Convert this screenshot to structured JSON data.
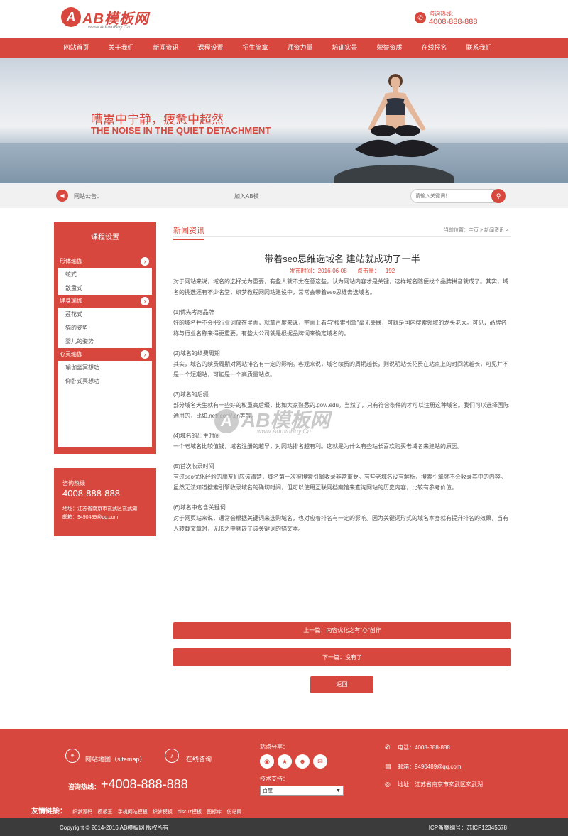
{
  "header": {
    "logo_mark": "A",
    "logo_text": "AB模板网",
    "logo_sub": "www.AdminBuy.Cn",
    "hotline_label": "咨询热线:",
    "hotline_number": "4008-888-888"
  },
  "nav": [
    "网站首页",
    "关于我们",
    "新闻资讯",
    "课程设置",
    "招生简章",
    "师资力量",
    "培训实景",
    "荣誉资质",
    "在线报名",
    "联系我们"
  ],
  "banner": {
    "headline_cn": "嘈嚣中宁静，疲惫中超然",
    "headline_en": "THE NOISE IN THE QUIET DETACHMENT"
  },
  "notice": {
    "label": "网站公告：",
    "text": "加入AB模",
    "search_placeholder": "请输入关键词！"
  },
  "sidebar": {
    "title": "课程设置",
    "groups": [
      {
        "label": "形体瑜伽",
        "items": [
          "蛇式",
          "散盘式"
        ]
      },
      {
        "label": "健身瑜伽",
        "items": [
          "莲花式",
          "猫的姿势",
          "婴儿的姿势"
        ]
      },
      {
        "label": "心灵瑜伽",
        "items": [
          "瑜伽坐冥想功",
          "仰卧式冥想功"
        ]
      }
    ],
    "contact": {
      "label": "咨询热线",
      "number": "4008-888-888",
      "address": "地址：江苏省南京市玄武区玄武湖",
      "email": "邮箱：9490489@qq.com"
    }
  },
  "main": {
    "section_title": "新闻资讯",
    "breadcrumb": "当前位置：主页 > 新闻资讯 >",
    "article_title": "带着seo思维选域名 建站就成功了一半",
    "publish_label": "发布时间：",
    "publish_date": "2016-06-08",
    "views_label": "点击量：",
    "views": "192",
    "paragraphs": [
      {
        "heading": "",
        "text": "对于网站来说，域名的选择尤为重要，有些人就不太在意这些，认为网站内容才是关键，这样域名随便找个品牌拼音就成了。其实，域名的挑选还有不少名堂，织梦教程网网站建设中，常常会带着seo思维去选域名。"
      },
      {
        "heading": "(1)优先考虑品牌",
        "text": "好的域名并不会把行业词放在里面，就拿百度来说，字面上看与“搜索引擎”毫无关联，可就是国内搜索领域的龙头老大。可见，品牌名称与行业名称来得更重要，有些大公司就是根据品牌词来确定域名的。"
      },
      {
        "heading": "(2)域名的续费周期",
        "text": "其实，域名的续费周期对网站排名有一定的影响。客观来说，域名续费的周期越长，则说明站长花费在站点上的时间就越长，可见并不是一个短期站，可能是一个高质量站点。"
      },
      {
        "heading": "(3)域名的后缀",
        "text": "部分域名天生就有一些好的权重高后缀，比如大家熟悉的.gov/.edu。当然了，只有符合条件的才可以注册这种域名。我们可以选择国际通用的，比如.net/.com/.cn等等。"
      },
      {
        "heading": "(4)域名的出生时间",
        "text": "一个老域名比较值钱，域名注册的越早，对网站排名越有利。这就是为什么有些站长喜欢购买老域名来建站的原因。"
      },
      {
        "heading": "(5)首次收录时间",
        "text": "有过seo优化经验的朋友们应该清楚，域名第一次被搜索引擎收录非常重要。有些老域名没有解析，搜索引擎就不会收录其中的内容。虽然无法知道搜索引擎收录域名的确切时间，但可以使用互联网档案馆来查询网站的历史内容，比较有参考价值。"
      },
      {
        "heading": "(6)域名中包含关键词",
        "text": "对于网页站来说，通常会根据关键词来选购域名，也对应着排名有一定的影响。因为关键词形式的域名本身就有提升排名的效果，当有人转载文章时，无形之中就嵌了该关键词的锚文本。"
      }
    ],
    "watermark_mark": "A",
    "watermark_text": "AB模板网",
    "watermark_sub": "www.AdminBuy.Cn",
    "prev_label": "上一篇：内容优化之有“心”创作",
    "next_label": "下一篇：没有了",
    "back_label": "返回"
  },
  "footer": {
    "sitemap": "网站地图（sitemap）",
    "consult": "在线咨询",
    "hotline_label": "咨询热线：",
    "hotline_number": "+4008-888-888",
    "share_label": "站点分享：",
    "tech_label": "技术支持：",
    "tech_select": "百度",
    "phone": "电话：4008-888-888",
    "email": "邮箱：9490489@qq.com",
    "address": "地址：江苏省南京市玄武区玄武湖",
    "links_label": "友情链接：",
    "links": [
      "织梦源码",
      "模板王",
      "手机网站模板",
      "织梦模板",
      "discuz模板",
      "图标库",
      "仿站网"
    ],
    "copyright": "Copyright © 2014-2016 AB模板网 版权所有",
    "icp": "ICP备案编号：苏ICP12345678"
  },
  "colors": {
    "accent": "#d8473d",
    "footer_bottom": "#3b3b3b",
    "notice_bg": "#f1f1f1"
  }
}
